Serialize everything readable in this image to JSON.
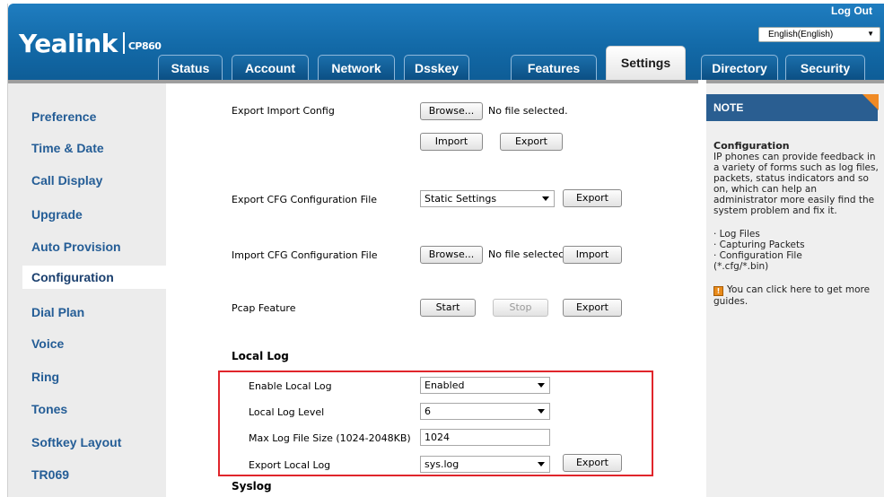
{
  "header": {
    "logo_text": "Yealink",
    "model": "CP860",
    "logout": "Log Out",
    "language": "English(English)"
  },
  "tabs": [
    {
      "label": "Status"
    },
    {
      "label": "Account"
    },
    {
      "label": "Network"
    },
    {
      "label": "Dsskey"
    },
    {
      "label": "Features"
    },
    {
      "label": "Settings",
      "active": true
    },
    {
      "label": "Directory"
    },
    {
      "label": "Security"
    }
  ],
  "sidebar": {
    "items": [
      {
        "label": "Preference"
      },
      {
        "label": "Time & Date"
      },
      {
        "label": "Call Display"
      },
      {
        "label": "Upgrade"
      },
      {
        "label": "Auto Provision"
      },
      {
        "label": "Configuration",
        "active": true
      },
      {
        "label": "Dial Plan"
      },
      {
        "label": "Voice"
      },
      {
        "label": "Ring"
      },
      {
        "label": "Tones"
      },
      {
        "label": "Softkey Layout"
      },
      {
        "label": "TR069"
      }
    ]
  },
  "main": {
    "export_import": {
      "label": "Export Import Config",
      "browse": "Browse...",
      "file_status": "No file selected.",
      "import": "Import",
      "export": "Export"
    },
    "export_cfg": {
      "label": "Export CFG Configuration File",
      "select": "Static Settings",
      "export": "Export"
    },
    "import_cfg": {
      "label": "Import CFG Configuration File",
      "browse": "Browse...",
      "file_status": "No file selectec",
      "import": "Import"
    },
    "pcap": {
      "label": "Pcap Feature",
      "start": "Start",
      "stop": "Stop",
      "export": "Export"
    },
    "local_log": {
      "heading": "Local Log",
      "enable_label": "Enable Local Log",
      "enable_value": "Enabled",
      "level_label": "Local Log Level",
      "level_value": "6",
      "max_size_label": "Max Log File Size (1024-2048KB)",
      "max_size_value": "1024",
      "export_label": "Export Local Log",
      "export_select": "sys.log",
      "export_button": "Export"
    },
    "syslog_heading": "Syslog"
  },
  "note": {
    "heading": "NOTE",
    "title": "Configuration",
    "description": "IP phones can provide feedback in a variety of forms such as log files, packets, status indicators and so on, which can help an administrator more easily find the system problem and fix it.",
    "items": [
      "· Log Files",
      "· Capturing Packets",
      "· Configuration File",
      "(*.cfg/*.bin)"
    ],
    "guide_text": "You can click here to get more guides.",
    "guide_icon": "book-icon"
  },
  "colors": {
    "header_blue": "#136aa8",
    "sidebar_link": "#245d96",
    "note_header": "#2a5e91",
    "note_corner": "#f08a24",
    "highlight_box": "#e0252b"
  }
}
